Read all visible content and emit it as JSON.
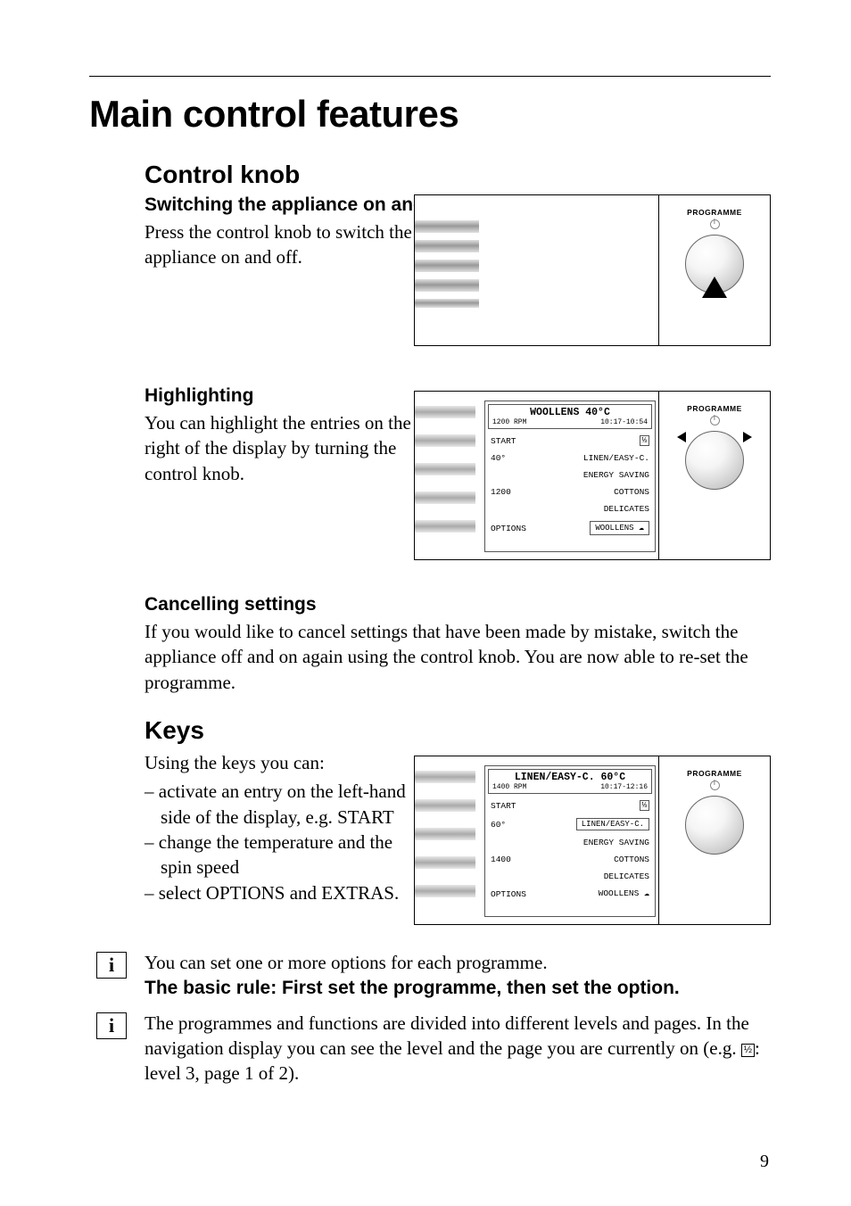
{
  "page_number": "9",
  "title": "Main control features",
  "sections": {
    "control_knob": {
      "heading": "Control knob",
      "switching": {
        "heading": "Switching the appliance on and off",
        "text": "Press the control knob to switch the appliance on and off."
      },
      "highlighting": {
        "heading": "Highlighting",
        "text": "You can highlight the entries on the right of the display by turning the control knob."
      },
      "cancelling": {
        "heading": "Cancelling settings",
        "text": "If you would like to cancel settings that have been made by mistake, switch the appliance off and on again using the control knob. You are now able to re-set the programme."
      }
    },
    "keys": {
      "heading": "Keys",
      "intro": "Using the keys you can:",
      "bullets": [
        "activate an entry on the left-hand side of the display, e.g. START",
        "change the temperature and the spin speed",
        "select OPTIONS and EXTRAS."
      ]
    }
  },
  "panels": {
    "programme_label": "PROGRAMME",
    "lcd_woollens": {
      "title": "WOOLLENS 40°C",
      "rpm": "1200 RPM",
      "time": "10:17-10:54",
      "left": [
        "START",
        "40°",
        "1200",
        "OPTIONS"
      ],
      "right": [
        "LINEN/EASY-C.",
        "ENERGY SAVING",
        "COTTONS",
        "DELICATES",
        "WOOLLENS"
      ]
    },
    "lcd_linen": {
      "title": "LINEN/EASY-C. 60°C",
      "rpm": "1400 RPM",
      "time": "10:17-12:16",
      "left": [
        "START",
        "60°",
        "1400",
        "OPTIONS"
      ],
      "right": [
        "LINEN/EASY-C.",
        "ENERGY SAVING",
        "COTTONS",
        "DELICATES",
        "WOOLLENS"
      ]
    }
  },
  "info": {
    "note1_line1": "You can set one or more options for each programme.",
    "note1_line2": "The basic rule: First set the programme, then set the option.",
    "note2_part1": "The programmes and functions are divided into different levels and pages. In the navigation display you can see the level and the page you are currently on (e.g. ",
    "note2_icon": "½",
    "note2_part2": ": level 3, page 1 of 2)."
  }
}
